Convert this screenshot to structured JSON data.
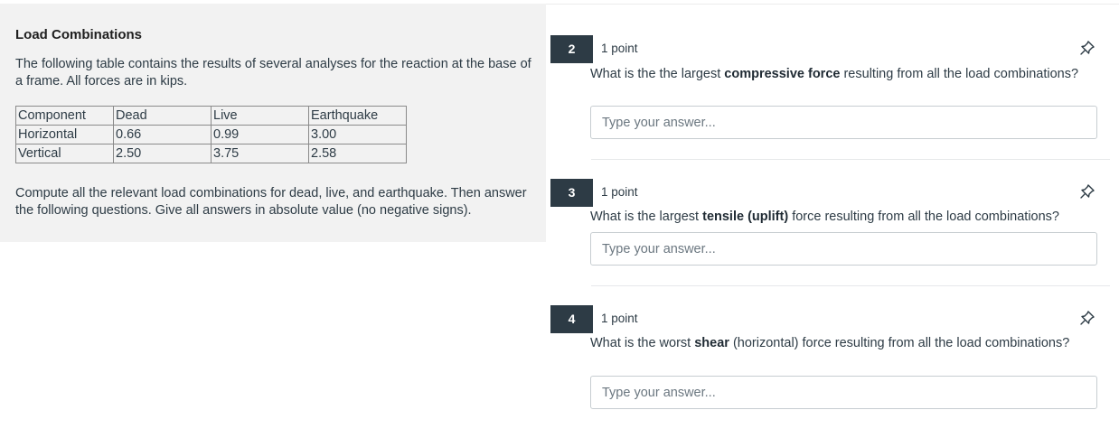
{
  "left": {
    "title": "Load Combinations",
    "intro": "The following table contains the results of several analyses for the reaction at the base of a frame. All forces are in kips.",
    "table": {
      "headers": [
        "Component",
        "Dead",
        "Live",
        "Earthquake"
      ],
      "rows": [
        [
          "Horizontal",
          "0.66",
          "0.99",
          "3.00"
        ],
        [
          "Vertical",
          "2.50",
          "3.75",
          "2.58"
        ]
      ]
    },
    "instructions": "Compute all the relevant load combinations for dead, live, and earthquake. Then answer the following questions. Give all answers in absolute value (no negative signs)."
  },
  "questions": [
    {
      "number": "2",
      "points": "1 point",
      "text_before": "What is the the largest ",
      "text_bold": "compressive force",
      "text_after": " resulting from all the load combinations?",
      "placeholder": "Type your answer..."
    },
    {
      "number": "3",
      "points": "1 point",
      "text_before": "What is the largest ",
      "text_bold": "tensile (uplift)",
      "text_after": " force resulting from all the load combinations?",
      "placeholder": "Type your answer..."
    },
    {
      "number": "4",
      "points": "1 point",
      "text_before": "What is the worst ",
      "text_bold": "shear",
      "text_after": " (horizontal) force resulting from all the load combinations?",
      "placeholder": "Type your answer..."
    }
  ],
  "icons": {
    "pin": "pin-icon"
  },
  "colors": {
    "badge": "#2d3b45",
    "panel": "#f2f2f2",
    "text": "#2d3b45"
  }
}
